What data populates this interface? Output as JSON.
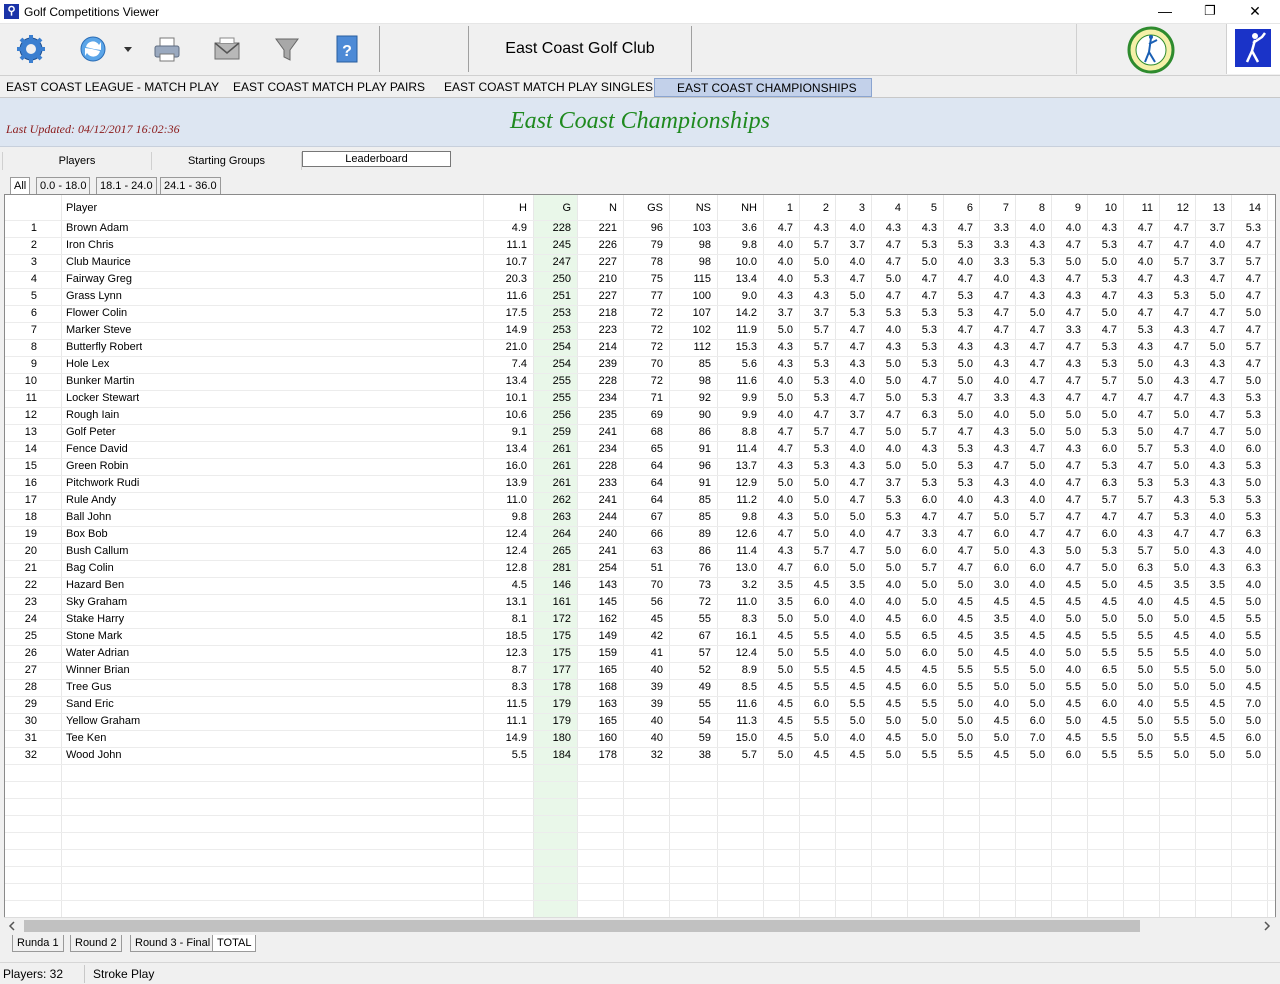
{
  "window": {
    "title": "Golf Competitions Viewer",
    "minimize": "—",
    "restore": "❐",
    "close": "✕"
  },
  "toolbar": {
    "icons": [
      "settings-icon",
      "refresh-icon",
      "dropdown-arrow-icon",
      "print-icon",
      "email-icon",
      "filter-icon",
      "help-icon"
    ],
    "club_name": "East Coast Golf Club"
  },
  "competitions": [
    "EAST COAST LEAGUE - MATCH PLAY",
    "EAST COAST MATCH PLAY PAIRS",
    "EAST COAST MATCH PLAY SINGLES",
    "EAST COAST CHAMPIONSHIPS"
  ],
  "active_competition": 3,
  "header": {
    "last_updated": "Last Updated:  04/12/2017 16:02:36",
    "title": "East Coast Championships"
  },
  "view_tabs": [
    "Players",
    "Starting Groups",
    "Leaderboard"
  ],
  "active_view": 2,
  "filter_tabs": [
    "All",
    "0.0 - 18.0",
    "18.1 - 24.0",
    "24.1 - 36.0"
  ],
  "active_filter": 0,
  "columns": [
    "",
    "Player",
    "H",
    "G",
    "N",
    "GS",
    "NS",
    "NH",
    "1",
    "2",
    "3",
    "4",
    "5",
    "6",
    "7",
    "8",
    "9",
    "10",
    "11",
    "12",
    "13",
    "14"
  ],
  "rows": [
    [
      "1",
      "Brown Adam",
      "4.9",
      "228",
      "221",
      "96",
      "103",
      "3.6",
      "4.7",
      "4.3",
      "4.0",
      "4.3",
      "4.3",
      "4.7",
      "3.3",
      "4.0",
      "4.0",
      "4.3",
      "4.7",
      "4.7",
      "3.7",
      "5.3"
    ],
    [
      "2",
      "Iron Chris",
      "11.1",
      "245",
      "226",
      "79",
      "98",
      "9.8",
      "4.0",
      "5.7",
      "3.7",
      "4.7",
      "5.3",
      "5.3",
      "3.3",
      "4.3",
      "4.7",
      "5.3",
      "4.7",
      "4.7",
      "4.0",
      "4.7"
    ],
    [
      "3",
      "Club Maurice",
      "10.7",
      "247",
      "227",
      "78",
      "98",
      "10.0",
      "4.0",
      "5.0",
      "4.0",
      "4.7",
      "5.0",
      "4.0",
      "3.3",
      "5.3",
      "5.0",
      "5.0",
      "4.0",
      "5.7",
      "3.7",
      "5.7"
    ],
    [
      "4",
      "Fairway Greg",
      "20.3",
      "250",
      "210",
      "75",
      "115",
      "13.4",
      "4.0",
      "5.3",
      "4.7",
      "5.0",
      "4.7",
      "4.7",
      "4.0",
      "4.3",
      "4.7",
      "5.3",
      "4.7",
      "4.3",
      "4.7",
      "4.7"
    ],
    [
      "5",
      "Grass Lynn",
      "11.6",
      "251",
      "227",
      "77",
      "100",
      "9.0",
      "4.3",
      "4.3",
      "5.0",
      "4.7",
      "4.7",
      "5.3",
      "4.7",
      "4.3",
      "4.3",
      "4.7",
      "4.3",
      "5.3",
      "5.0",
      "4.7"
    ],
    [
      "6",
      "Flower Colin",
      "17.5",
      "253",
      "218",
      "72",
      "107",
      "14.2",
      "3.7",
      "3.7",
      "5.3",
      "5.3",
      "5.3",
      "5.3",
      "4.7",
      "5.0",
      "4.7",
      "5.0",
      "4.7",
      "4.7",
      "4.7",
      "5.0"
    ],
    [
      "7",
      "Marker Steve",
      "14.9",
      "253",
      "223",
      "72",
      "102",
      "11.9",
      "5.0",
      "5.7",
      "4.7",
      "4.0",
      "5.3",
      "4.7",
      "4.7",
      "4.7",
      "3.3",
      "4.7",
      "5.3",
      "4.3",
      "4.7",
      "4.7"
    ],
    [
      "8",
      "Butterfly Robert",
      "21.0",
      "254",
      "214",
      "72",
      "112",
      "15.3",
      "4.3",
      "5.7",
      "4.7",
      "4.3",
      "5.3",
      "4.3",
      "4.3",
      "4.7",
      "4.7",
      "5.3",
      "4.3",
      "4.7",
      "5.0",
      "5.7"
    ],
    [
      "9",
      "Hole Lex",
      "7.4",
      "254",
      "239",
      "70",
      "85",
      "5.6",
      "4.3",
      "5.3",
      "4.3",
      "5.0",
      "5.3",
      "5.0",
      "4.3",
      "4.7",
      "4.3",
      "5.3",
      "5.0",
      "4.3",
      "4.3",
      "4.7"
    ],
    [
      "10",
      "Bunker Martin",
      "13.4",
      "255",
      "228",
      "72",
      "98",
      "11.6",
      "4.0",
      "5.3",
      "4.0",
      "5.0",
      "4.7",
      "5.0",
      "4.0",
      "4.7",
      "4.7",
      "5.7",
      "5.0",
      "4.3",
      "4.7",
      "5.0"
    ],
    [
      "11",
      "Locker Stewart",
      "10.1",
      "255",
      "234",
      "71",
      "92",
      "9.9",
      "5.0",
      "5.3",
      "4.7",
      "5.0",
      "5.3",
      "4.7",
      "3.3",
      "4.3",
      "4.7",
      "4.7",
      "4.7",
      "4.7",
      "4.3",
      "5.3"
    ],
    [
      "12",
      "Rough Iain",
      "10.6",
      "256",
      "235",
      "69",
      "90",
      "9.9",
      "4.0",
      "4.7",
      "3.7",
      "4.7",
      "6.3",
      "5.0",
      "4.0",
      "5.0",
      "5.0",
      "5.0",
      "4.7",
      "5.0",
      "4.7",
      "5.3"
    ],
    [
      "13",
      "Golf Peter",
      "9.1",
      "259",
      "241",
      "68",
      "86",
      "8.8",
      "4.7",
      "5.7",
      "4.7",
      "5.0",
      "5.7",
      "4.7",
      "4.3",
      "5.0",
      "5.0",
      "5.3",
      "5.0",
      "4.7",
      "4.7",
      "5.0"
    ],
    [
      "14",
      "Fence David",
      "13.4",
      "261",
      "234",
      "65",
      "91",
      "11.4",
      "4.7",
      "5.3",
      "4.0",
      "4.0",
      "4.3",
      "5.3",
      "4.3",
      "4.7",
      "4.3",
      "6.0",
      "5.7",
      "5.3",
      "4.0",
      "6.0"
    ],
    [
      "15",
      "Green Robin",
      "16.0",
      "261",
      "228",
      "64",
      "96",
      "13.7",
      "4.3",
      "5.3",
      "4.3",
      "5.0",
      "5.0",
      "5.3",
      "4.7",
      "5.0",
      "4.7",
      "5.3",
      "4.7",
      "5.0",
      "4.3",
      "5.3"
    ],
    [
      "16",
      "Pitchwork Rudi",
      "13.9",
      "261",
      "233",
      "64",
      "91",
      "12.9",
      "5.0",
      "5.0",
      "4.7",
      "3.7",
      "5.3",
      "5.3",
      "4.3",
      "4.0",
      "4.7",
      "6.3",
      "5.3",
      "5.3",
      "4.3",
      "5.0"
    ],
    [
      "17",
      "Rule Andy",
      "11.0",
      "262",
      "241",
      "64",
      "85",
      "11.2",
      "4.0",
      "5.0",
      "4.7",
      "5.3",
      "6.0",
      "4.0",
      "4.3",
      "4.0",
      "4.7",
      "5.7",
      "5.7",
      "4.3",
      "5.3",
      "5.3"
    ],
    [
      "18",
      "Ball John",
      "9.8",
      "263",
      "244",
      "67",
      "85",
      "9.8",
      "4.3",
      "5.0",
      "5.0",
      "5.3",
      "4.7",
      "4.7",
      "5.0",
      "5.7",
      "4.7",
      "4.7",
      "4.7",
      "5.3",
      "4.0",
      "5.3"
    ],
    [
      "19",
      "Box Bob",
      "12.4",
      "264",
      "240",
      "66",
      "89",
      "12.6",
      "4.7",
      "5.0",
      "4.0",
      "4.7",
      "3.3",
      "4.7",
      "6.0",
      "4.7",
      "4.7",
      "6.0",
      "4.3",
      "4.7",
      "4.7",
      "6.3"
    ],
    [
      "20",
      "Bush Callum",
      "12.4",
      "265",
      "241",
      "63",
      "86",
      "11.4",
      "4.3",
      "5.7",
      "4.7",
      "5.0",
      "6.0",
      "4.7",
      "5.0",
      "4.3",
      "5.0",
      "5.3",
      "5.7",
      "5.0",
      "4.3",
      "4.0"
    ],
    [
      "21",
      "Bag Colin",
      "12.8",
      "281",
      "254",
      "51",
      "76",
      "13.0",
      "4.7",
      "6.0",
      "5.0",
      "5.0",
      "5.7",
      "4.7",
      "6.0",
      "6.0",
      "4.7",
      "5.0",
      "6.3",
      "5.0",
      "4.3",
      "6.3"
    ],
    [
      "22",
      "Hazard Ben",
      "4.5",
      "146",
      "143",
      "70",
      "73",
      "3.2",
      "3.5",
      "4.5",
      "3.5",
      "4.0",
      "5.0",
      "5.0",
      "3.0",
      "4.0",
      "4.5",
      "5.0",
      "4.5",
      "3.5",
      "3.5",
      "4.0"
    ],
    [
      "23",
      "Sky Graham",
      "13.1",
      "161",
      "145",
      "56",
      "72",
      "11.0",
      "3.5",
      "6.0",
      "4.0",
      "4.0",
      "5.0",
      "4.5",
      "4.5",
      "4.5",
      "4.5",
      "4.5",
      "4.0",
      "4.5",
      "4.5",
      "5.0"
    ],
    [
      "24",
      "Stake Harry",
      "8.1",
      "172",
      "162",
      "45",
      "55",
      "8.3",
      "5.0",
      "5.0",
      "4.0",
      "4.5",
      "6.0",
      "4.5",
      "3.5",
      "4.0",
      "5.0",
      "5.0",
      "5.0",
      "5.0",
      "4.5",
      "5.5"
    ],
    [
      "25",
      "Stone Mark",
      "18.5",
      "175",
      "149",
      "42",
      "67",
      "16.1",
      "4.5",
      "5.5",
      "4.0",
      "5.5",
      "6.5",
      "4.5",
      "3.5",
      "4.5",
      "4.5",
      "5.5",
      "5.5",
      "4.5",
      "4.0",
      "5.5"
    ],
    [
      "26",
      "Water Adrian",
      "12.3",
      "175",
      "159",
      "41",
      "57",
      "12.4",
      "5.0",
      "5.5",
      "4.0",
      "5.0",
      "6.0",
      "5.0",
      "4.5",
      "4.0",
      "5.0",
      "5.5",
      "5.5",
      "5.5",
      "4.0",
      "5.0"
    ],
    [
      "27",
      "Winner Brian",
      "8.7",
      "177",
      "165",
      "40",
      "52",
      "8.9",
      "5.0",
      "5.5",
      "4.5",
      "4.5",
      "4.5",
      "5.5",
      "5.5",
      "5.0",
      "4.0",
      "6.5",
      "5.0",
      "5.5",
      "5.0",
      "5.0"
    ],
    [
      "28",
      "Tree Gus",
      "8.3",
      "178",
      "168",
      "39",
      "49",
      "8.5",
      "4.5",
      "5.5",
      "4.5",
      "4.5",
      "6.0",
      "5.5",
      "5.0",
      "5.0",
      "5.5",
      "5.0",
      "5.0",
      "5.0",
      "5.0",
      "4.5"
    ],
    [
      "29",
      "Sand Eric",
      "11.5",
      "179",
      "163",
      "39",
      "55",
      "11.6",
      "4.5",
      "6.0",
      "5.5",
      "4.5",
      "5.5",
      "5.0",
      "4.0",
      "5.0",
      "4.5",
      "6.0",
      "4.0",
      "5.5",
      "4.5",
      "7.0"
    ],
    [
      "30",
      "Yellow Graham",
      "11.1",
      "179",
      "165",
      "40",
      "54",
      "11.3",
      "4.5",
      "5.5",
      "5.0",
      "5.0",
      "5.0",
      "5.0",
      "4.5",
      "6.0",
      "5.0",
      "4.5",
      "5.0",
      "5.5",
      "5.0",
      "5.0"
    ],
    [
      "31",
      "Tee Ken",
      "14.9",
      "180",
      "160",
      "40",
      "59",
      "15.0",
      "4.5",
      "5.0",
      "4.0",
      "4.5",
      "5.0",
      "5.0",
      "5.0",
      "7.0",
      "4.5",
      "5.5",
      "5.0",
      "5.5",
      "4.5",
      "6.0"
    ],
    [
      "32",
      "Wood John",
      "5.5",
      "184",
      "178",
      "32",
      "38",
      "5.7",
      "5.0",
      "4.5",
      "4.5",
      "5.0",
      "5.5",
      "5.5",
      "4.5",
      "5.0",
      "6.0",
      "5.5",
      "5.5",
      "5.0",
      "5.0",
      "5.0"
    ]
  ],
  "round_tabs": [
    "Runda 1",
    "Round 2",
    "Round 3 - Final",
    "TOTAL"
  ],
  "active_round": 3,
  "status": {
    "players": "Players: 32",
    "mode": "Stroke Play"
  },
  "colors": {
    "highlight_column": "#e9f7e9",
    "title_green": "#1f8a1f",
    "last_updated_red": "#8b1a1a"
  }
}
